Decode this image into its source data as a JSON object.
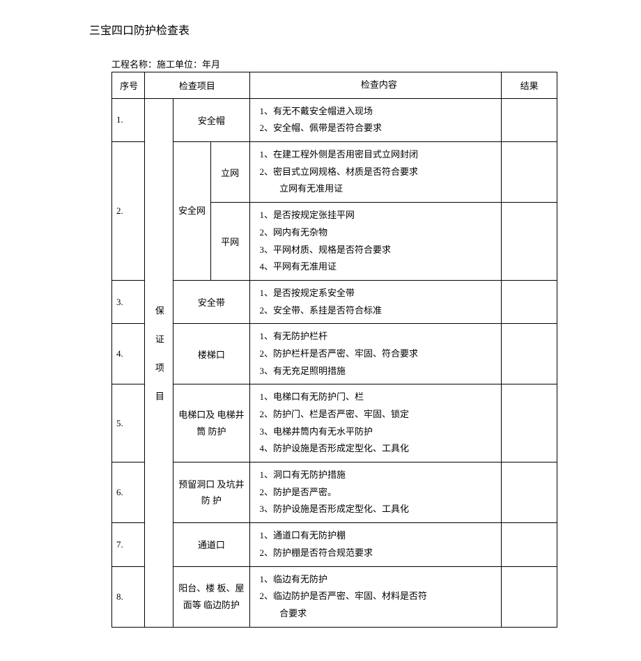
{
  "title": "三宝四口防护检查表",
  "subtitle": "工程名称：施工单位：年月",
  "headers": {
    "seq": "序号",
    "item": "检查项目",
    "content": "检查内容",
    "result": "结果"
  },
  "group": "保证项目",
  "rows": [
    {
      "seq": "1.",
      "item": "安全帽",
      "content": "1、有无不戴安全帽进入现场\n2、安全帽、佩带是否符合要求"
    },
    {
      "seq": "2.",
      "item": "安全网",
      "sub1": {
        "name": "立网",
        "content": "1、在建工程外侧是否用密目式立网封闭\n2、密目式立网规格、材质是否符合要求\n　　立网有无准用证"
      },
      "sub2": {
        "name": "平网",
        "content": "1、是否按规定张挂平网\n2、网内有无杂物\n3、平网材质、规格是否符合要求\n4、平网有无准用证"
      }
    },
    {
      "seq": "3.",
      "item": "安全带",
      "content": "1、是否按规定系安全带\n2、安全带、系挂是否符合标准"
    },
    {
      "seq": "4.",
      "item": "楼梯口",
      "content": "1、有无防护栏杆\n2、防护栏杆是否严密、牢固、符合要求\n3、有无充足照明措施"
    },
    {
      "seq": "5.",
      "item": "电梯口及 电梯井筒 防护",
      "content": "1、电梯口有无防护门、栏\n2、防护门、栏是否严密、牢固、锁定\n3、电梯井筒内有无水平防护\n4、防护设施是否形成定型化、工具化"
    },
    {
      "seq": "6.",
      "item": "预留洞口 及坑井防 护",
      "content": "1、洞口有无防护措施\n2、防护是否严密。\n3、防护设施是否形成定型化、工具化"
    },
    {
      "seq": "7.",
      "item": "通道口",
      "content": "1、通道口有无防护棚\n2、防护棚是否符合规范要求"
    },
    {
      "seq": "8.",
      "item": "阳台、楼 板、屋面等 临边防护",
      "content": "1、临边有无防护\n2、临边防护是否严密、牢固、材料是否符\n　　合要求"
    }
  ]
}
